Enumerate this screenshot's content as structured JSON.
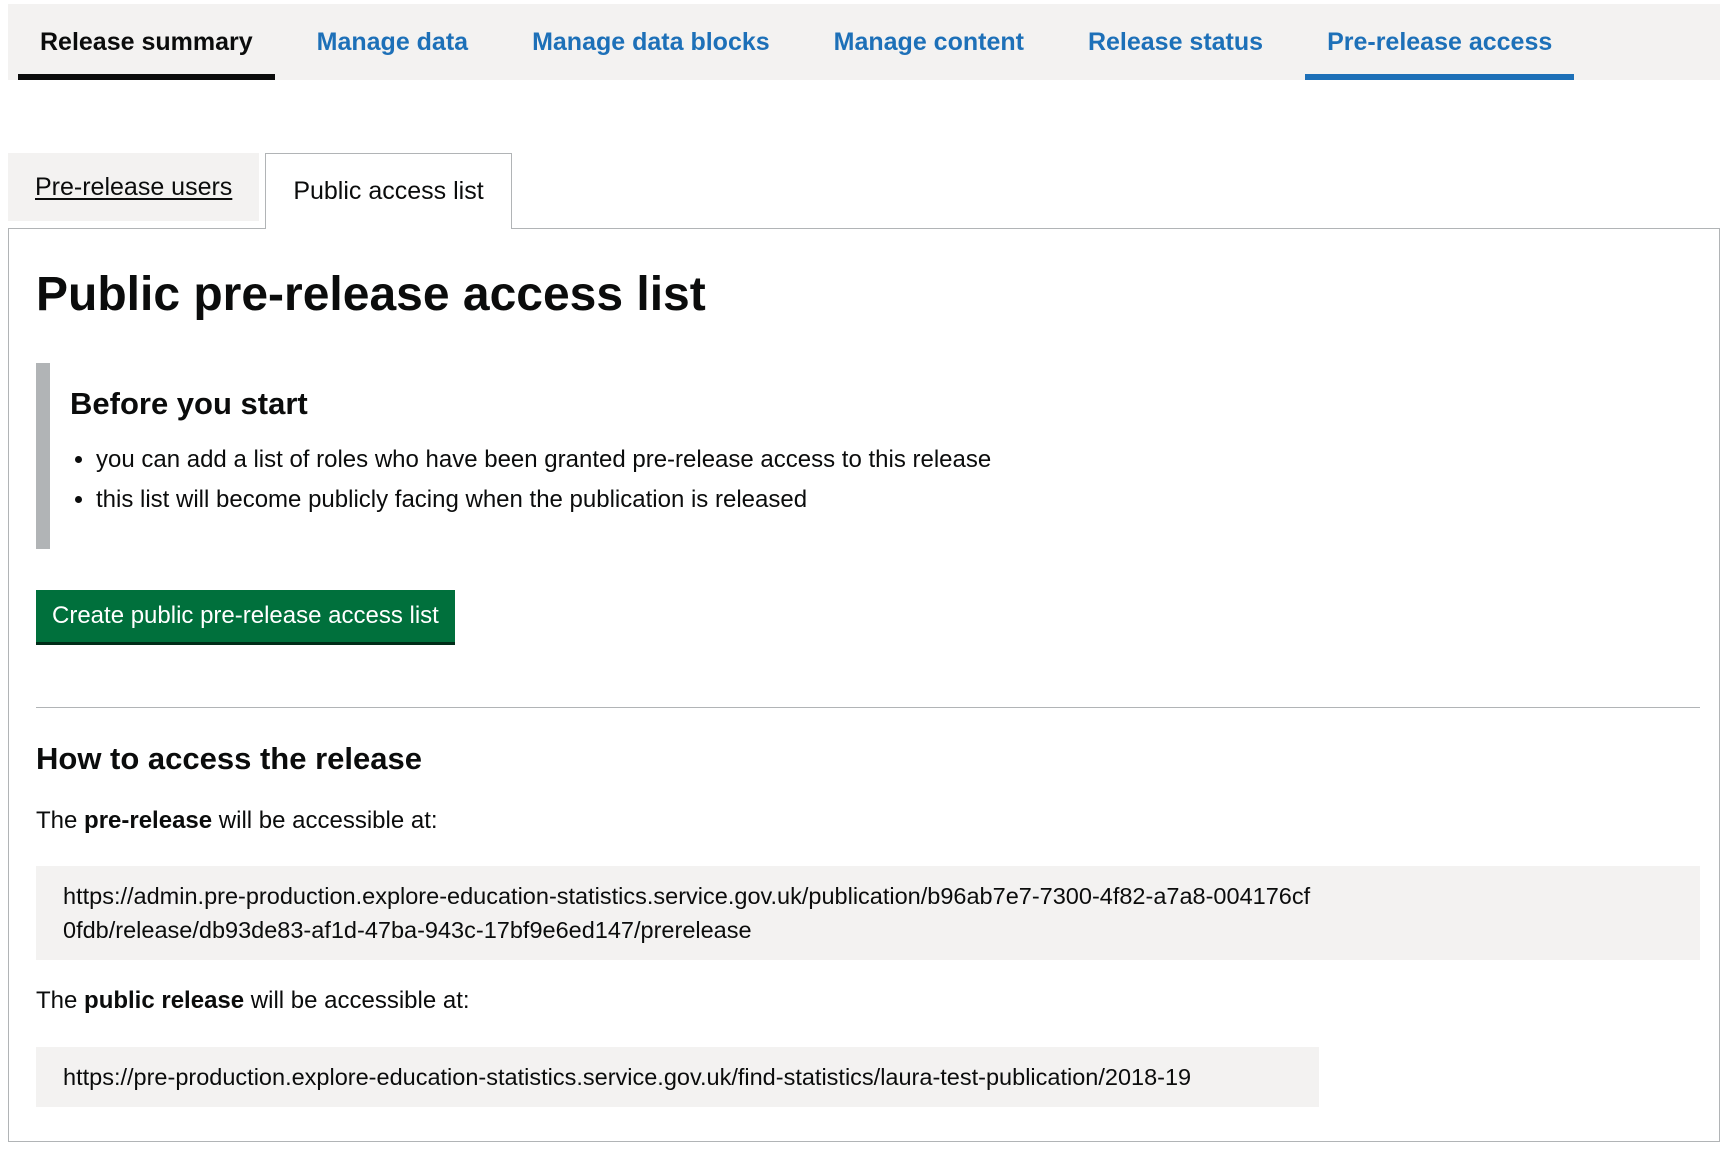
{
  "nav": {
    "items": [
      {
        "label": "Release summary"
      },
      {
        "label": "Manage data"
      },
      {
        "label": "Manage data blocks"
      },
      {
        "label": "Manage content"
      },
      {
        "label": "Release status"
      },
      {
        "label": "Pre-release access"
      }
    ]
  },
  "tabs": {
    "items": [
      {
        "label": "Pre-release users"
      },
      {
        "label": "Public access list"
      }
    ]
  },
  "panel": {
    "title": "Public pre-release access list",
    "inset": {
      "heading": "Before you start",
      "bullets": [
        "you can add a list of roles who have been granted pre-release access to this release",
        "this list will become publicly facing when the publication is released"
      ]
    },
    "create_button_label": "Create public pre-release access list",
    "how_to": {
      "heading": "How to access the release",
      "pre": {
        "prefix": "The ",
        "bold": "pre-release",
        "suffix": " will be accessible at:",
        "url": "https://admin.pre-production.explore-education-statistics.service.gov.uk/publication/b96ab7e7-7300-4f82-a7a8-004176cf0fdb/release/db93de83-af1d-47ba-943c-17bf9e6ed147/prerelease"
      },
      "public": {
        "prefix": "The ",
        "bold": "public release",
        "suffix": " will be accessible at:",
        "url": "https://pre-production.explore-education-statistics.service.gov.uk/find-statistics/laura-test-publication/2018-19"
      }
    }
  },
  "colors": {
    "link_blue": "#1d70b8",
    "text": "#0b0c0c",
    "button_green": "#00703c",
    "light_grey": "#f3f2f1",
    "border_grey": "#b1b4b6"
  }
}
